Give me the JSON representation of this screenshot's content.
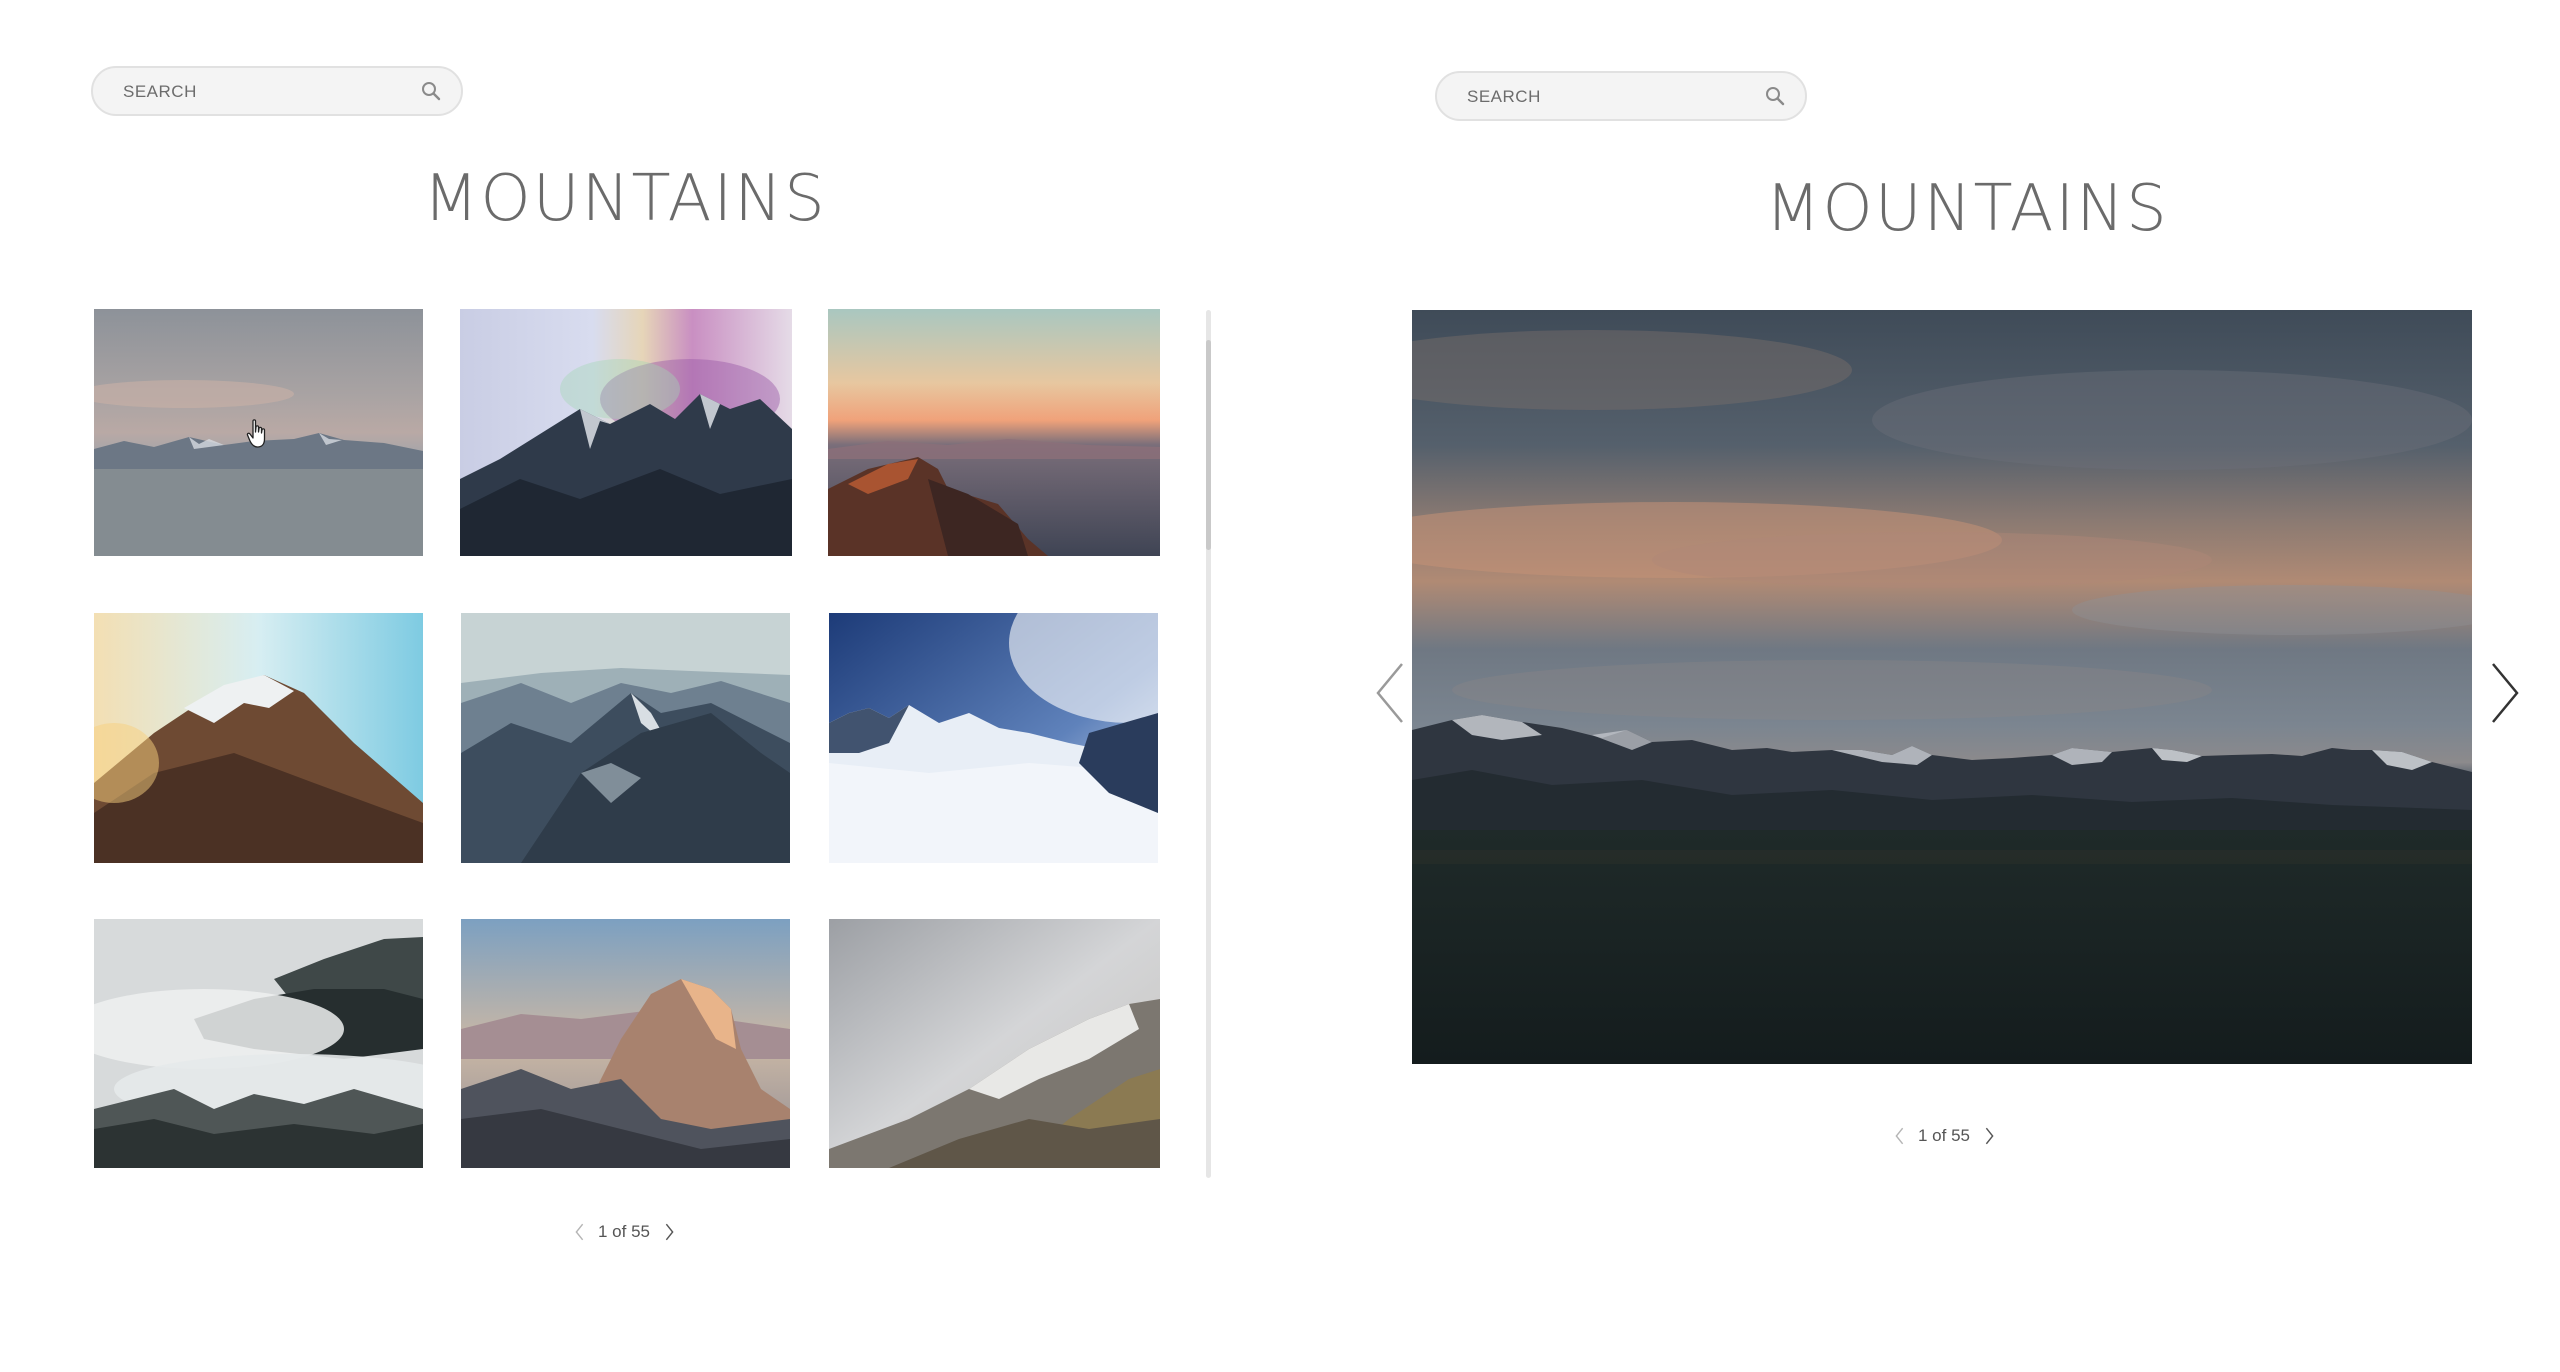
{
  "gallery_view": {
    "search": {
      "placeholder": "SEARCH",
      "value": ""
    },
    "title": "MOUNTAINS",
    "thumbnails": [
      {
        "name": "thumb-dusk-range"
      },
      {
        "name": "thumb-rainbow-fog-peaks"
      },
      {
        "name": "thumb-sunset-cliff"
      },
      {
        "name": "thumb-snowy-forest-peak"
      },
      {
        "name": "thumb-blue-ridges"
      },
      {
        "name": "thumb-snowfield-range"
      },
      {
        "name": "thumb-misty-forest"
      },
      {
        "name": "thumb-half-dome"
      },
      {
        "name": "thumb-foggy-slope"
      }
    ],
    "pager": {
      "label": "1 of 55",
      "current_page": 1,
      "total_pages": 55
    }
  },
  "detail_view": {
    "search": {
      "placeholder": "SEARCH",
      "value": ""
    },
    "title": "MOUNTAINS",
    "photo": {
      "name": "dusk-mountain-range-photo"
    },
    "pager": {
      "label": "1 of 55",
      "current_page": 1,
      "total_pages": 55
    }
  },
  "icons": {
    "search": "search-icon",
    "prev": "chevron-left-icon",
    "next": "chevron-right-icon",
    "cursor": "hand-pointer-icon"
  },
  "colors": {
    "text": "#6b6b6b",
    "search_bg": "#f4f4f4",
    "search_border": "#e1e1e1",
    "scrollbar": "#c9c9c9"
  }
}
